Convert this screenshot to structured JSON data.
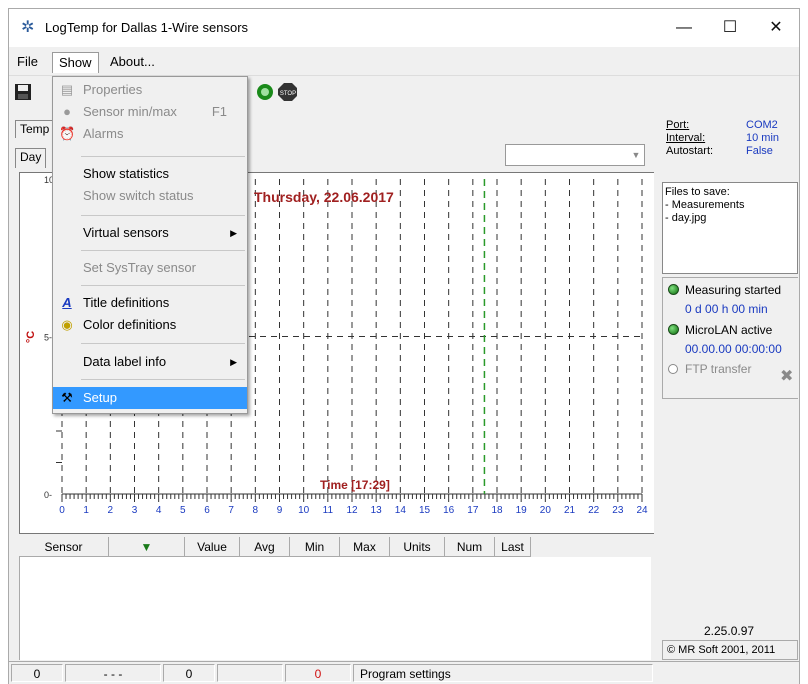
{
  "window": {
    "title": "LogTemp for Dallas 1-Wire sensors",
    "minimize": "—",
    "maximize": "☐",
    "close": "✕"
  },
  "menu": {
    "file": "File",
    "show": "Show",
    "about": "About..."
  },
  "show_menu": {
    "properties": "Properties",
    "sensor_minmax": "Sensor min/max",
    "sensor_minmax_shortcut": "F1",
    "alarms": "Alarms",
    "show_statistics": "Show statistics",
    "show_switch_status": "Show switch status",
    "virtual_sensors": "Virtual sensors",
    "set_systray_sensor": "Set SysTray sensor",
    "title_definitions": "Title definitions",
    "color_definitions": "Color definitions",
    "data_label_info": "Data label info",
    "setup": "Setup"
  },
  "tabs": {
    "temp": "Temp",
    "day": "Day"
  },
  "chart": {
    "date_title": "Thursday, 22.06.2017",
    "time_label": "Time [17:29]",
    "y_unit": "°C",
    "y_tick_top": "10-",
    "y_tick_mid": "5-",
    "y_tick_zero": "0-",
    "x_ticks": [
      "0",
      "1",
      "2",
      "3",
      "4",
      "5",
      "6",
      "7",
      "8",
      "9",
      "10",
      "11",
      "12",
      "13",
      "14",
      "15",
      "16",
      "17",
      "18",
      "19",
      "20",
      "21",
      "22",
      "23",
      "24"
    ],
    "current_time_hour": 17.48
  },
  "chart_data": {
    "type": "line",
    "title": "Thursday, 22.06.2017",
    "xlabel": "Time [17:29]",
    "ylabel": "°C",
    "x": [
      0,
      1,
      2,
      3,
      4,
      5,
      6,
      7,
      8,
      9,
      10,
      11,
      12,
      13,
      14,
      15,
      16,
      17,
      18,
      19,
      20,
      21,
      22,
      23,
      24
    ],
    "xlim": [
      0,
      24
    ],
    "ylim": [
      0,
      10
    ],
    "series": [],
    "grid": true
  },
  "info_panel": {
    "port_label": "Port:",
    "port_value": "COM2",
    "interval_label": "Interval:",
    "interval_value": "10 min",
    "autostart_label": "Autostart:",
    "autostart_value": "False"
  },
  "files_panel": {
    "header": "Files to save:",
    "items": [
      "- Measurements",
      "- day.jpg"
    ]
  },
  "status_panel": {
    "measuring": "Measuring started",
    "measuring_time": "0 d 00 h 00 min",
    "microlan": "MicroLAN active",
    "microlan_time": "00.00.00 00:00:00",
    "ftp": "FTP transfer"
  },
  "version": "2.25.0.97",
  "copyright": "© MR Soft 2001, 2011",
  "table": {
    "columns": [
      "Sensor",
      "Value",
      "Avg",
      "Min",
      "Max",
      "Units",
      "Num",
      "Last"
    ]
  },
  "statusbar": {
    "cell1": "0",
    "cell2": "- - -",
    "cell3": "0",
    "cell4": "",
    "cell5": "0",
    "cell6": "Program settings"
  },
  "colors": {
    "date_title": "#a02020",
    "time_label": "#a02020",
    "axis_ticks": "#1a3ac0",
    "current_time_line": "#2a9a2a",
    "highlight": "#3399ff"
  }
}
